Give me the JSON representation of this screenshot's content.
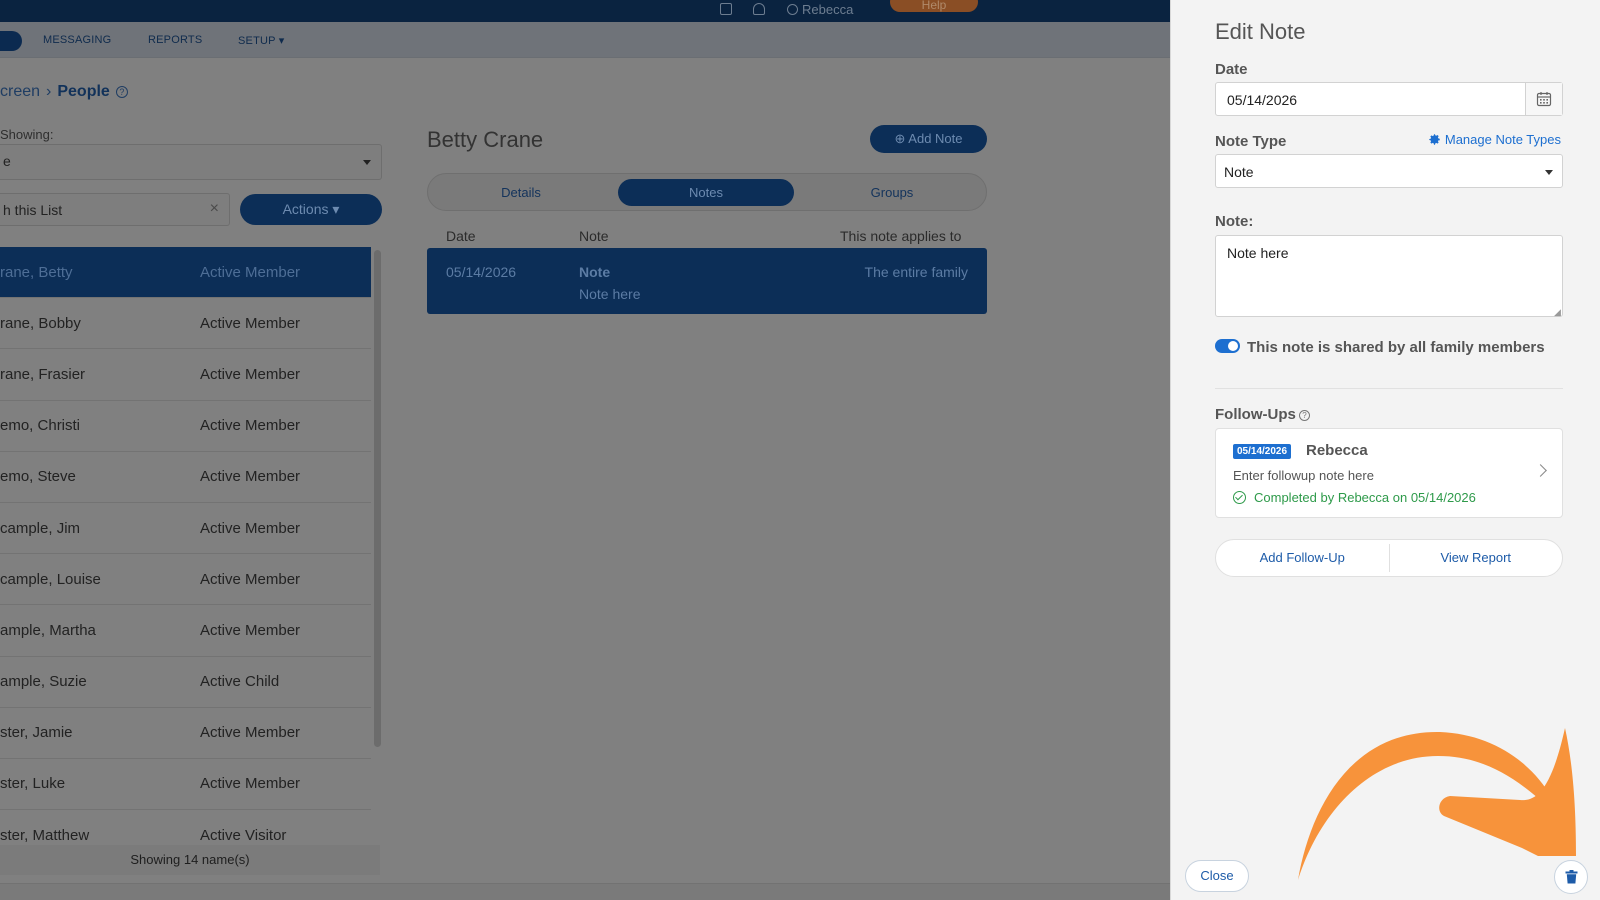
{
  "topbar": {
    "user_name": "Rebecca",
    "help_label": "Help"
  },
  "nav": {
    "items": [
      "MESSAGING",
      "REPORTS",
      "SETUP"
    ]
  },
  "breadcrumb": {
    "parent": "creen",
    "current": "People",
    "help_glyph": "?"
  },
  "list_panel": {
    "showing_label": "Showing:",
    "showing_value": "e",
    "search_value": "h this List",
    "actions_label": "Actions",
    "rows": [
      {
        "name": "rane, Betty",
        "status": "Active Member"
      },
      {
        "name": "rane, Bobby",
        "status": "Active Member"
      },
      {
        "name": "rane, Frasier",
        "status": "Active Member"
      },
      {
        "name": "emo, Christi",
        "status": "Active Member"
      },
      {
        "name": "emo, Steve",
        "status": "Active Member"
      },
      {
        "name": "cample, Jim",
        "status": "Active Member"
      },
      {
        "name": "cample, Louise",
        "status": "Active Member"
      },
      {
        "name": "ample, Martha",
        "status": "Active Member"
      },
      {
        "name": "ample, Suzie",
        "status": "Active Child"
      },
      {
        "name": "ster, Jamie",
        "status": "Active Member"
      },
      {
        "name": "ster, Luke",
        "status": "Active Member"
      },
      {
        "name": "ster, Matthew",
        "status": "Active Visitor"
      }
    ],
    "footer": "Showing 14 name(s)"
  },
  "person": {
    "name": "Betty Crane",
    "add_note_label": "Add Note",
    "tabs": [
      "Details",
      "Notes",
      "Groups"
    ],
    "active_tab": "Notes",
    "notes_headers": {
      "date": "Date",
      "note": "Note",
      "applies": "This note applies to"
    },
    "note_row": {
      "date": "05/14/2026",
      "type": "Note",
      "text": "Note here",
      "applies": "The entire family"
    }
  },
  "edit_note": {
    "title": "Edit Note",
    "date_label": "Date",
    "date_value": "05/14/2026",
    "type_label": "Note Type",
    "manage_link": "Manage Note Types",
    "type_value": "Note",
    "note_label": "Note:",
    "note_value": "Note here",
    "shared_label": "This note is shared by all family members",
    "shared_on": true,
    "followups_label": "Follow-Ups",
    "followup": {
      "date": "05/14/2026",
      "person": "Rebecca",
      "note": "Enter followup note here",
      "completed": "Completed by Rebecca on 05/14/2026"
    },
    "add_followup_label": "Add Follow-Up",
    "view_report_label": "View Report",
    "close_label": "Close"
  },
  "colors": {
    "accent": "#1d6fd0",
    "navy": "#0c2e57",
    "success": "#2e9a4a",
    "annotation_arrow": "#f7933b"
  },
  "icons": [
    "calendar-icon",
    "gear-icon",
    "help-circle-icon",
    "check-circle-icon",
    "chevron-right-icon",
    "trash-icon",
    "plus-circle-icon",
    "bell-icon",
    "user-icon"
  ]
}
